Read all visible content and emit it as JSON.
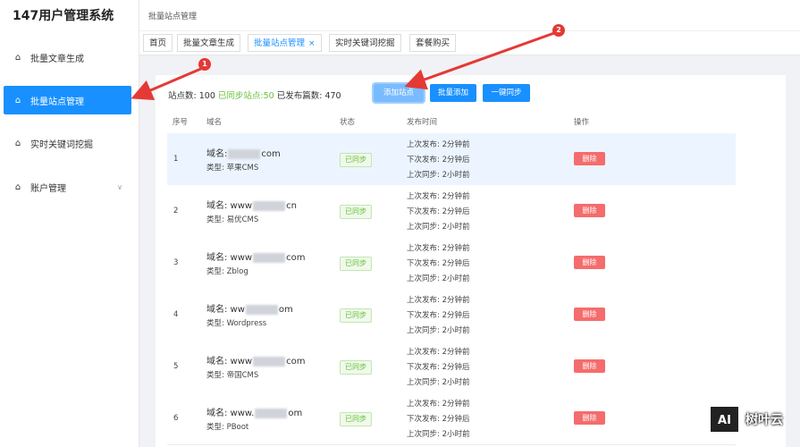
{
  "app": {
    "title": "147用户管理系统"
  },
  "sidebar": {
    "items": [
      {
        "label": "批量文章生成",
        "icon": "home-icon"
      },
      {
        "label": "批量站点管理",
        "icon": "home-icon",
        "active": true
      },
      {
        "label": "实时关键词挖掘",
        "icon": "home-icon"
      },
      {
        "label": "账户管理",
        "icon": "home-icon"
      }
    ]
  },
  "header": {
    "breadcrumb": "批量站点管理"
  },
  "tabs": [
    {
      "label": "首页"
    },
    {
      "label": "批量文章生成"
    },
    {
      "label": "批量站点管理",
      "active": true,
      "close": "×"
    },
    {
      "label": "实时关键词挖掘"
    },
    {
      "label": "套餐购买"
    }
  ],
  "stats": {
    "site_count_label": "站点数:",
    "site_count": "100",
    "synced_label": "已同步站点:",
    "synced": "50",
    "published_label": "已发布篇数:",
    "published": "470"
  },
  "toolbar": {
    "add_site": "添加站点",
    "batch_add": "批量添加",
    "one_sync": "一键同步"
  },
  "table": {
    "headers": {
      "no": "序号",
      "domain": "域名",
      "status": "状态",
      "time": "发布时间",
      "action": "操作"
    },
    "rows": [
      {
        "no": "1",
        "domain_prefix": "域名:",
        "domain_suffix": "com",
        "type": "类型: 苹果CMS",
        "status": "已同步",
        "last_publish": "上次发布: 2分钟前",
        "next_publish": "下次发布: 2分钟后",
        "last_sync": "上次同步: 2小时前",
        "delete": "删除"
      },
      {
        "no": "2",
        "domain_prefix": "域名: www",
        "domain_suffix": "cn",
        "type": "类型: 易优CMS",
        "status": "已同步",
        "last_publish": "上次发布: 2分钟前",
        "next_publish": "下次发布: 2分钟后",
        "last_sync": "上次同步: 2小时前",
        "delete": "删除"
      },
      {
        "no": "3",
        "domain_prefix": "域名: www",
        "domain_suffix": "com",
        "type": "类型: Zblog",
        "status": "已同步",
        "last_publish": "上次发布: 2分钟前",
        "next_publish": "下次发布: 2分钟后",
        "last_sync": "上次同步: 2小时前",
        "delete": "删除"
      },
      {
        "no": "4",
        "domain_prefix": "域名: ww",
        "domain_suffix": "om",
        "type": "类型: Wordpress",
        "status": "已同步",
        "last_publish": "上次发布: 2分钟前",
        "next_publish": "下次发布: 2分钟后",
        "last_sync": "上次同步: 2小时前",
        "delete": "删除"
      },
      {
        "no": "5",
        "domain_prefix": "域名: www",
        "domain_suffix": "com",
        "type": "类型: 帝国CMS",
        "status": "已同步",
        "last_publish": "上次发布: 2分钟前",
        "next_publish": "下次发布: 2分钟后",
        "last_sync": "上次同步: 2小时前",
        "delete": "删除"
      },
      {
        "no": "6",
        "domain_prefix": "域名: www.",
        "domain_suffix": "om",
        "type": "类型: PBoot",
        "status": "已同步",
        "last_publish": "上次发布: 2分钟前",
        "next_publish": "下次发布: 2分钟后",
        "last_sync": "上次同步: 2小时前",
        "delete": "删除"
      }
    ]
  },
  "callouts": {
    "one": "1",
    "two": "2"
  },
  "watermark": {
    "logo": "AI",
    "text": "树叶云"
  },
  "colors": {
    "primary": "#1890ff",
    "success": "#67c23a",
    "danger": "#f56c6c",
    "callout": "#e53935"
  }
}
